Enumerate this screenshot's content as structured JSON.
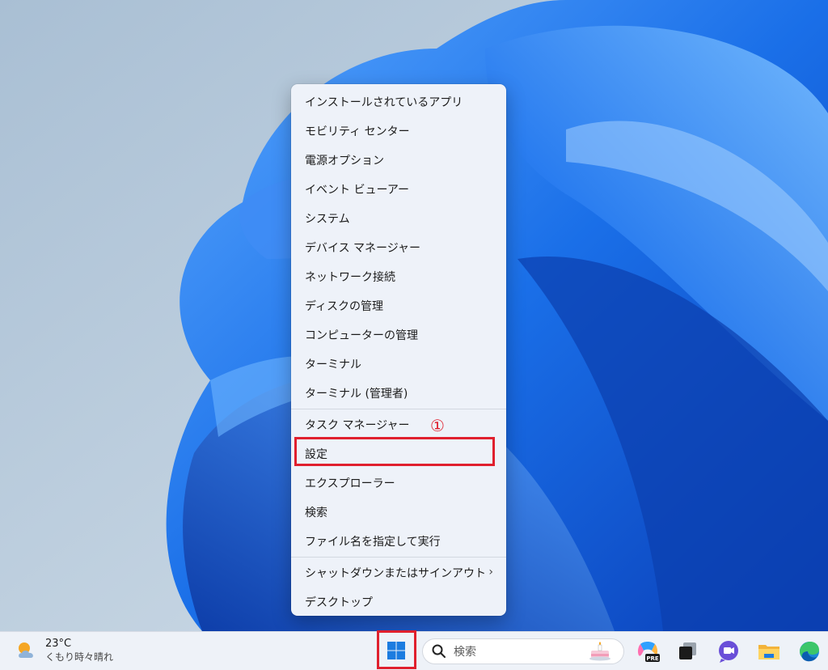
{
  "menu": {
    "items": [
      {
        "label": "インストールされているアプリ"
      },
      {
        "label": "モビリティ センター"
      },
      {
        "label": "電源オプション"
      },
      {
        "label": "イベント ビューアー"
      },
      {
        "label": "システム"
      },
      {
        "label": "デバイス マネージャー"
      },
      {
        "label": "ネットワーク接続"
      },
      {
        "label": "ディスクの管理"
      },
      {
        "label": "コンピューターの管理"
      },
      {
        "label": "ターミナル"
      },
      {
        "label": "ターミナル (管理者)"
      },
      {
        "label": "タスク マネージャー"
      },
      {
        "label": "設定"
      },
      {
        "label": "エクスプローラー"
      },
      {
        "label": "検索"
      },
      {
        "label": "ファイル名を指定して実行"
      },
      {
        "label": "シャットダウンまたはサインアウト"
      },
      {
        "label": "デスクトップ"
      }
    ],
    "submenu_glyph": "›"
  },
  "annotation": {
    "step_marker": "①",
    "color": "#e0202e"
  },
  "taskbar": {
    "weather": {
      "temperature": "23°C",
      "condition": "くもり時々晴れ"
    },
    "search": {
      "placeholder": "検索"
    },
    "icons": [
      "start-windows-icon",
      "copilot-pre-icon",
      "task-view-icon",
      "teams-chat-icon",
      "file-explorer-icon",
      "edge-browser-icon"
    ]
  },
  "colors": {
    "menu_background": "#eef2f9",
    "taskbar_background": "#eef2f8",
    "wallpaper_blue": "#1a6fe8",
    "highlight_red": "#e0202e"
  }
}
